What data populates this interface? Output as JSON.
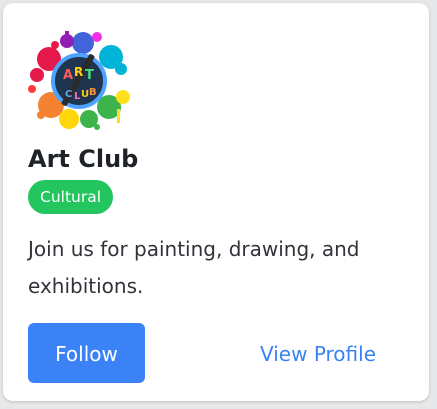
{
  "club": {
    "logo_icon": "art-palette-splash-icon",
    "logo_text": "ART CLUB",
    "name": "Art Club",
    "category": "Cultural",
    "description": "Join us for painting, drawing, and exhibitions."
  },
  "actions": {
    "follow_label": "Follow",
    "view_profile_label": "View Profile"
  },
  "colors": {
    "accent": "#3b82f6",
    "badge": "#22c55e",
    "text": "#1f2328"
  }
}
